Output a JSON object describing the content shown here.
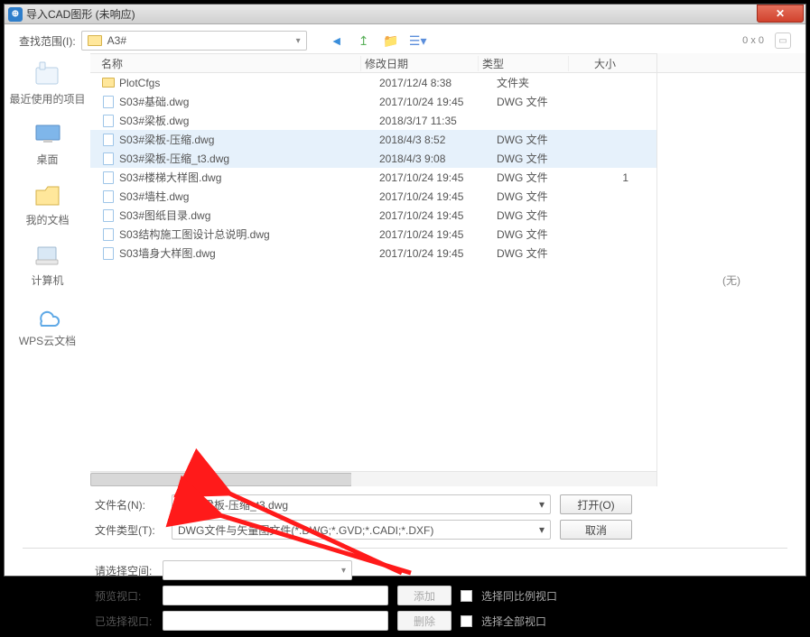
{
  "title": "导入CAD图形 (未响应)",
  "toolbar": {
    "label": "查找范围(I):",
    "folder": "A3#",
    "coord": "0 x 0"
  },
  "sidebar": {
    "recent": "最近使用的项目",
    "desktop": "桌面",
    "docs": "我的文档",
    "computer": "计算机",
    "wps": "WPS云文档"
  },
  "columns": {
    "name": "名称",
    "date": "修改日期",
    "type": "类型",
    "size": "大小"
  },
  "files": [
    {
      "name": "PlotCfgs",
      "date": "2017/12/4 8:38",
      "type": "文件夹",
      "size": "",
      "kind": "folder",
      "sel": false
    },
    {
      "name": "S03#基础.dwg",
      "date": "2017/10/24 19:45",
      "type": "DWG 文件",
      "size": "",
      "kind": "dwg",
      "sel": false
    },
    {
      "name": "S03#梁板.dwg",
      "date": "2018/3/17 11:35",
      "type": "",
      "size": "",
      "kind": "dwg",
      "sel": false
    },
    {
      "name": "S03#梁板-压缩.dwg",
      "date": "2018/4/3 8:52",
      "type": "DWG 文件",
      "size": "",
      "kind": "dwg",
      "sel": true
    },
    {
      "name": "S03#梁板-压缩_t3.dwg",
      "date": "2018/4/3 9:08",
      "type": "DWG 文件",
      "size": "",
      "kind": "dwg",
      "sel": true
    },
    {
      "name": "S03#楼梯大样图.dwg",
      "date": "2017/10/24 19:45",
      "type": "DWG 文件",
      "size": "1",
      "kind": "dwg",
      "sel": false
    },
    {
      "name": "S03#墙柱.dwg",
      "date": "2017/10/24 19:45",
      "type": "DWG 文件",
      "size": "",
      "kind": "dwg",
      "sel": false
    },
    {
      "name": "S03#图纸目录.dwg",
      "date": "2017/10/24 19:45",
      "type": "DWG 文件",
      "size": "",
      "kind": "dwg",
      "sel": false
    },
    {
      "name": "S03结构施工图设计总说明.dwg",
      "date": "2017/10/24 19:45",
      "type": "DWG 文件",
      "size": "",
      "kind": "dwg",
      "sel": false
    },
    {
      "name": "S03墙身大样图.dwg",
      "date": "2017/10/24 19:45",
      "type": "DWG 文件",
      "size": "",
      "kind": "dwg",
      "sel": false
    }
  ],
  "preview_text": "(无)",
  "filename": {
    "label": "文件名(N):",
    "value": "S03#梁板-压缩_t3.dwg"
  },
  "filetype": {
    "label": "文件类型(T):",
    "value": "DWG文件与矢量图文件(*.DWG;*.GVD;*.CADI;*.DXF)"
  },
  "open_btn": "打开(O)",
  "cancel_btn": "取消",
  "space": {
    "label": "请选择空间:"
  },
  "viewport": {
    "label": "预览视口:",
    "add": "添加",
    "same": "选择同比例视口"
  },
  "selview": {
    "label": "已选择视口:",
    "del": "删除",
    "all": "选择全部视口"
  }
}
